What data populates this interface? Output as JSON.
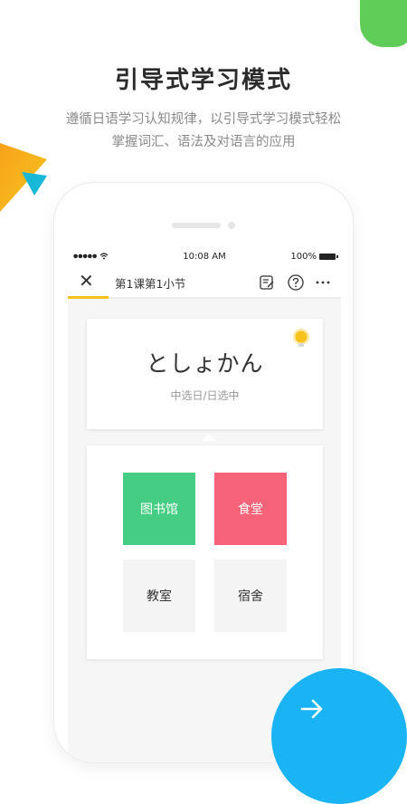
{
  "promo": {
    "headline": "引导式学习模式",
    "subtitle_line1": "遵循日语学习认知规律，以引导式学习模式轻松",
    "subtitle_line2": "掌握词汇、语法及对语言的应用"
  },
  "statusbar": {
    "signal": "●●●●●",
    "time": "10:08 AM",
    "battery": "100%"
  },
  "navbar": {
    "close_label": "✕",
    "title": "第1课第1小节",
    "progress_fraction": 0.15
  },
  "question": {
    "word": "としょかん",
    "hint": "中选日/日选中"
  },
  "options": [
    {
      "label": "图书馆",
      "state": "correct"
    },
    {
      "label": "食堂",
      "state": "wrong"
    },
    {
      "label": "教室",
      "state": "default"
    },
    {
      "label": "宿舍",
      "state": "default"
    }
  ],
  "colors": {
    "correct": "#46cd84",
    "wrong": "#f76479",
    "accent_blue": "#1ab4f4",
    "accent_yellow": "#f8c21c",
    "deco_green": "#5fcd58"
  },
  "icons": [
    "wifi-icon",
    "battery-icon",
    "close-icon",
    "notes-icon",
    "help-icon",
    "more-icon",
    "lightbulb-icon",
    "arrow-right-icon"
  ]
}
